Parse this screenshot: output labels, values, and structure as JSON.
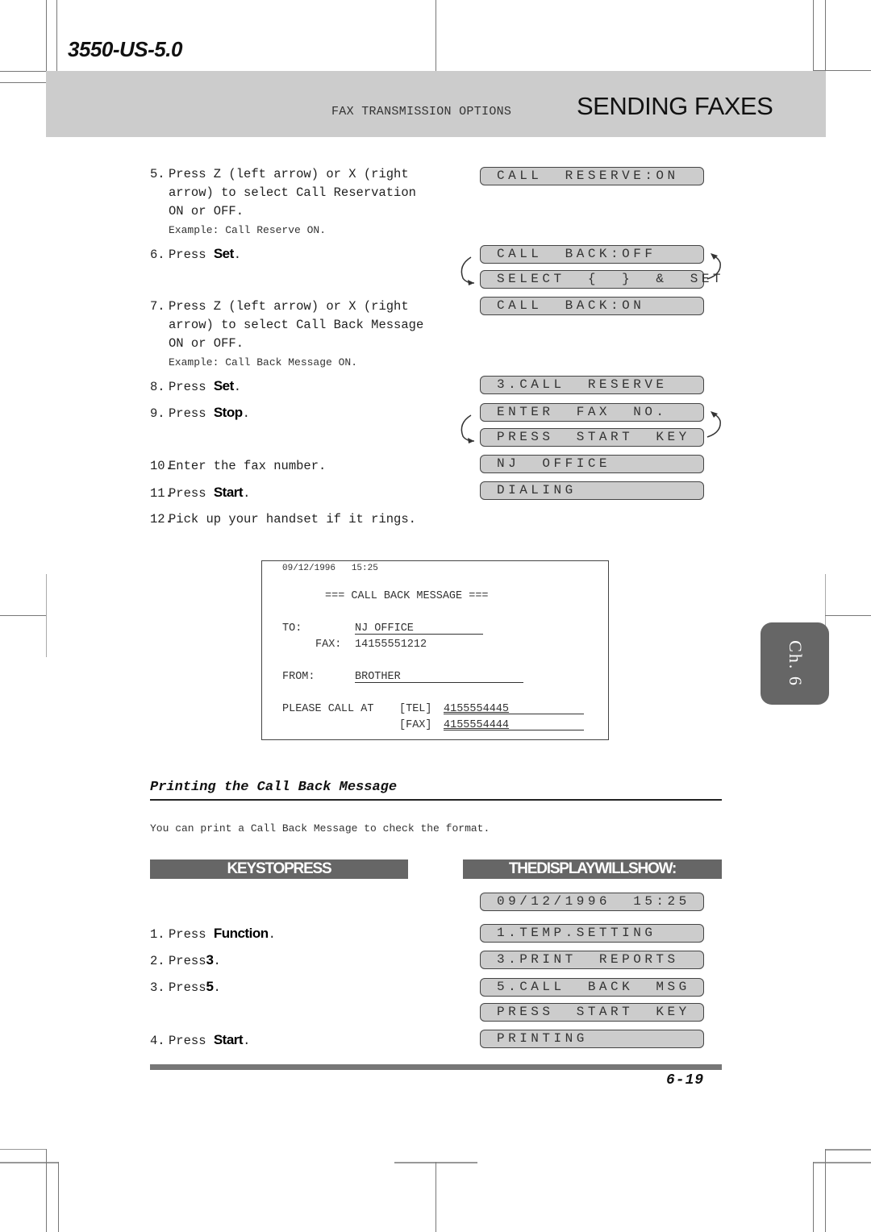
{
  "header": {
    "doc_id": "3550-US-5.0",
    "section_subtitle": "FAX TRANSMISSION OPTIONS",
    "section_title": "SENDING FAXES"
  },
  "steps_top": [
    {
      "num": "5.",
      "lines": [
        "Press Z (left arrow) or X (right",
        "arrow) to select Call Reservation",
        "ON or OFF."
      ],
      "example": "Example: Call Reserve ON."
    },
    {
      "num": "6.",
      "prefix": "Press",
      "key": "Set",
      "suffix": "."
    },
    {
      "num": "7.",
      "lines": [
        "Press Z (left arrow) or X (right",
        "arrow) to select Call Back Message",
        "ON or OFF."
      ],
      "example": "Example: Call Back Message ON."
    },
    {
      "num": "8.",
      "prefix": "Press",
      "key": "Set",
      "suffix": "."
    },
    {
      "num": "9.",
      "prefix": "Press",
      "key": "Stop",
      "suffix": "."
    },
    {
      "num": "10.",
      "text": "Enter the fax number."
    },
    {
      "num": "11.",
      "prefix": "Press",
      "key": "Start",
      "suffix": "."
    },
    {
      "num": "12.",
      "text": "Pick up your handset if it rings."
    }
  ],
  "displays_top": [
    "CALL  RESERVE:ON",
    "CALL  BACK:OFF",
    "SELECT  {  }  &  SET",
    "CALL  BACK:ON",
    "3.CALL  RESERVE",
    "ENTER  FAX  NO.",
    "PRESS  START  KEY",
    "NJ  OFFICE",
    "DIALING"
  ],
  "report": {
    "datetime": "09/12/1996   15:25",
    "title": "=== CALL BACK MESSAGE ===",
    "to_label": "TO:",
    "to_value": "NJ OFFICE",
    "fax_label": "FAX:",
    "fax_value": "14155551212",
    "from_label": "FROM:",
    "from_value": "BROTHER",
    "please_call": "PLEASE CALL AT",
    "tel_label": "[TEL]",
    "tel_value": "4155554445",
    "fax2_label": "[FAX]",
    "fax2_value": "4155554444"
  },
  "chapter_tab": "Ch. 6",
  "printing": {
    "heading": "Printing the Call Back Message",
    "intro": "You can print a Call Back Message to check the format.",
    "keys_header": "KEYSTOPRESS",
    "display_header": "THEDISPLAYWILLSHOW:",
    "steps": [
      {
        "num": "1.",
        "prefix": "Press",
        "key": "Function",
        "suffix": "."
      },
      {
        "num": "2.",
        "prefix": "Press",
        "key": "3",
        "suffix": "."
      },
      {
        "num": "3.",
        "prefix": "Press",
        "key": "5",
        "suffix": "."
      },
      {
        "num": "4.",
        "prefix": "Press",
        "key": "Start",
        "suffix": "."
      }
    ],
    "displays": [
      "09/12/1996  15:25",
      "1.TEMP.SETTING",
      "3.PRINT  REPORTS",
      "5.CALL  BACK  MSG",
      "PRESS  START  KEY",
      "PRINTING"
    ]
  },
  "footer": {
    "page_number": "6-19"
  }
}
